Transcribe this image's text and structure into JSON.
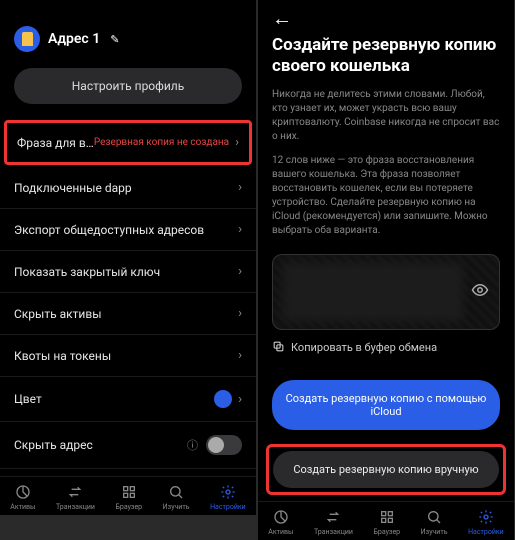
{
  "left": {
    "header": {
      "title": "Адрес 1"
    },
    "profile_button": "Настроить профиль",
    "rows": {
      "recovery": {
        "label": "Фраза для восстано...",
        "status": "Резервная копия не создана"
      },
      "dapp": {
        "label": "Подключенные dapp"
      },
      "export": {
        "label": "Экспорт общедоступных адресов"
      },
      "showkey": {
        "label": "Показать закрытый ключ"
      },
      "hideassets": {
        "label": "Скрыть активы"
      },
      "quotas": {
        "label": "Квоты на токены"
      },
      "color": {
        "label": "Цвет"
      },
      "hideaddr": {
        "label": "Скрыть адрес",
        "info": "ⓘ"
      }
    }
  },
  "right": {
    "title": "Создайте резервную копию своего кошелька",
    "p1": "Никогда не делитесь этими словами. Любой, кто узнает их, может украсть всю вашу криптовалюту. Coinbase никогда не спросит вас о них.",
    "p2": "12 слов ниже — это фраза восстановления вашего кошелька. Эта фраза позволяет восстановить кошелек, если вы потеряете устройство. Сделайте резервную копию на iCloud (рекомендуется) или запишите. Можно выбрать оба варианта.",
    "copy": "Копировать в буфер обмена",
    "icloud_btn": "Создать резервную копию с помощью iCloud",
    "manual_btn": "Создать резервную копию вручную"
  },
  "tabs": {
    "assets": "Активы",
    "tx": "Транзакции",
    "browser": "Браузер",
    "explore": "Изучить",
    "settings": "Настройки"
  }
}
